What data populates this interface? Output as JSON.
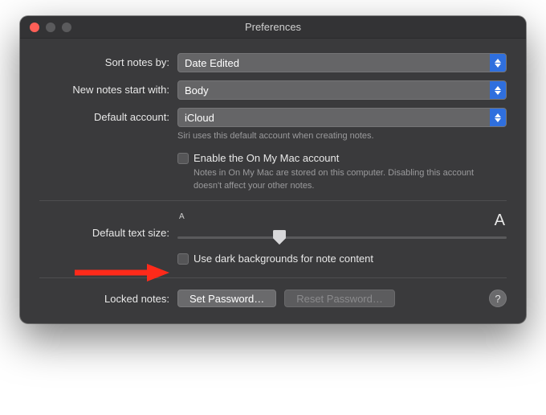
{
  "window": {
    "title": "Preferences"
  },
  "rows": {
    "sort_label": "Sort notes by:",
    "sort_value": "Date Edited",
    "new_notes_label": "New notes start with:",
    "new_notes_value": "Body",
    "default_account_label": "Default account:",
    "default_account_value": "iCloud",
    "default_account_hint": "Siri uses this default account when creating notes.",
    "enable_on_my_mac_label": "Enable the On My Mac account",
    "enable_on_my_mac_hint": "Notes in On My Mac are stored on this computer. Disabling this account doesn't affect your other notes.",
    "text_size_label": "Default text size:",
    "text_size_small_a": "A",
    "text_size_big_a": "A",
    "dark_bg_label": "Use dark backgrounds for note content",
    "locked_notes_label": "Locked notes:",
    "set_password_label": "Set Password…",
    "reset_password_label": "Reset Password…",
    "help_label": "?"
  }
}
